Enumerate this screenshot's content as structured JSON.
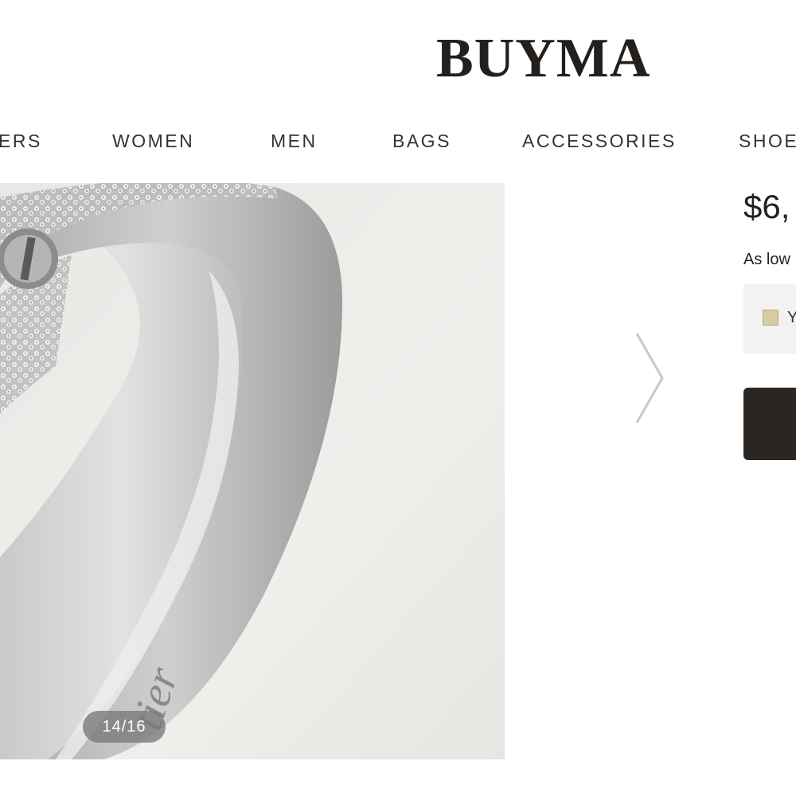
{
  "header": {
    "logo": "BUYMA"
  },
  "nav": {
    "items": [
      {
        "label": "ERS"
      },
      {
        "label": "WOMEN"
      },
      {
        "label": "MEN"
      },
      {
        "label": "BAGS"
      },
      {
        "label": "ACCESSORIES"
      },
      {
        "label": "SHOE"
      }
    ]
  },
  "gallery": {
    "counter": "14/16",
    "engraving": "tier"
  },
  "product": {
    "price": "$6,",
    "as_low_as": "As low",
    "option": {
      "label": "Y",
      "swatch_color": "#d8cc9c"
    }
  },
  "colors": {
    "logo": "#231f1c",
    "buy_button": "#2c2622",
    "option_box": "#f2f2f2"
  }
}
